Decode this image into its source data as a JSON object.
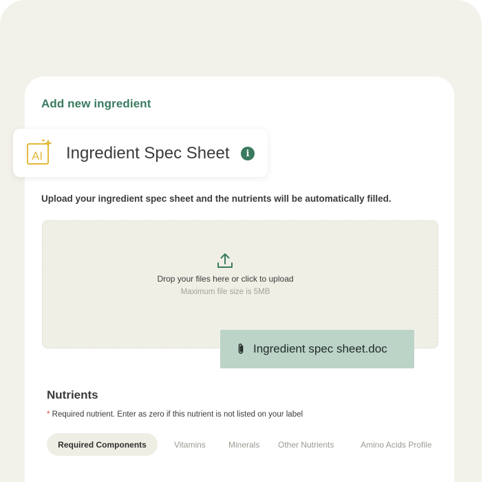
{
  "form": {
    "title": "Add new ingredient"
  },
  "spec_sheet": {
    "ai_icon_text": "AI",
    "title": "Ingredient Spec Sheet",
    "info_icon_glyph": "i"
  },
  "upload": {
    "description": "Upload your ingredient spec sheet and the nutrients will be automatically filled.",
    "drop_text": "Drop your files here or click to upload",
    "max_size_text": "Maximum file size is 5MB",
    "file_name": "Ingredient spec sheet.doc"
  },
  "nutrients": {
    "title": "Nutrients",
    "required_star": "*",
    "required_note": " Required nutrient. Enter as zero if this nutrient is not listed on your label",
    "tabs": [
      {
        "label": "Required Components",
        "active": true
      },
      {
        "label": "Vitamins",
        "active": false
      },
      {
        "label": "Minerals",
        "active": false
      },
      {
        "label": "Other Nutrients",
        "active": false
      },
      {
        "label": "Amino Acids Profile",
        "active": false
      }
    ]
  },
  "colors": {
    "accent_green": "#3a7a5f",
    "ai_gold": "#e2b93b",
    "chip_green": "#bcd3c8",
    "background": "#f3f2ea"
  },
  "icons": [
    "ai-sparkle-icon",
    "info-icon",
    "upload-icon",
    "paperclip-icon"
  ]
}
